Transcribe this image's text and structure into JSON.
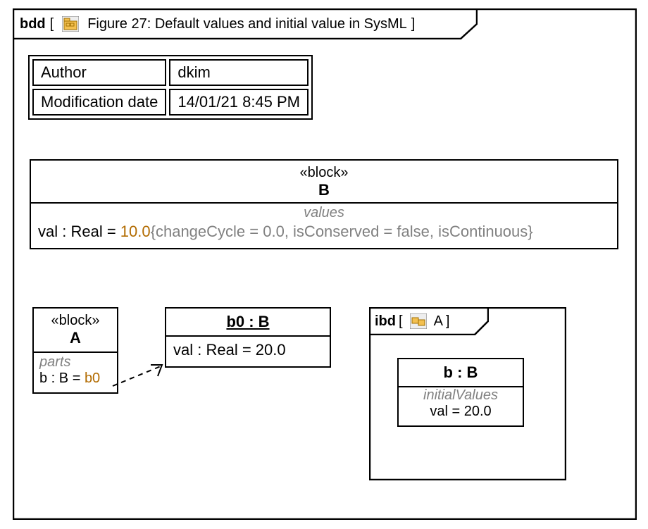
{
  "frame": {
    "kind": "bdd",
    "title": "Figure 27: Default values and initial value in SysML"
  },
  "meta": {
    "rows": [
      {
        "label": "Author",
        "value": "dkim"
      },
      {
        "label": "Modification date",
        "value": "14/01/21 8:45 PM"
      }
    ]
  },
  "blockB": {
    "stereotype": "«block»",
    "name": "B",
    "values_section_label": "values",
    "property": {
      "name": "val",
      "sep1": " : ",
      "type": "Real",
      "eq": " = ",
      "default": "10.0",
      "constraints": "{changeCycle = 0.0, isConserved = false, isContinuous}"
    }
  },
  "blockA": {
    "stereotype": "«block»",
    "name": "A",
    "parts_section_label": "parts",
    "part": {
      "name": "b",
      "sep1": " : ",
      "type": "B",
      "eq": " = ",
      "default": "b0"
    }
  },
  "instance": {
    "name_type": "b0 : B",
    "slot": {
      "name": "val",
      "sep1": " : ",
      "type": "Real",
      "eq": " = ",
      "value": "20.0"
    }
  },
  "ibd": {
    "kind": "ibd",
    "context": "A",
    "part": {
      "name_type": "b : B",
      "initial_label": "initialValues",
      "value_line": "val = 20.0"
    }
  },
  "brackets": {
    "open": "[",
    "close": "]"
  }
}
